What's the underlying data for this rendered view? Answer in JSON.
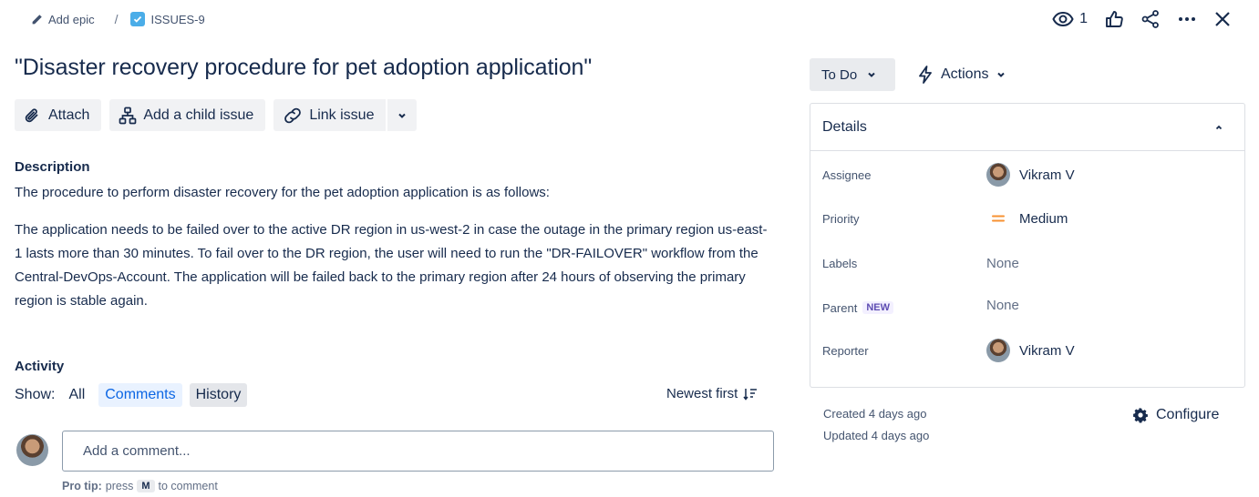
{
  "breadcrumb": {
    "epic_label": "Add epic",
    "separator": "/",
    "issue_key": "ISSUES-9"
  },
  "topbar": {
    "watch_count": "1"
  },
  "issue": {
    "title": "\"Disaster recovery procedure for pet adoption application\""
  },
  "toolbar": {
    "attach_label": "Attach",
    "child_issue_label": "Add a child issue",
    "link_issue_label": "Link issue"
  },
  "description": {
    "heading": "Description",
    "intro": "The procedure to perform disaster recovery for the pet adoption application is as follows:",
    "body": "The application needs to be failed over to the active DR region in us-west-2 in case the outage in the primary region us-east-1 lasts more than 30 minutes. To fail over to the DR region, the user will need to run the \"DR-FAILOVER\" workflow from the Central-DevOps-Account. The application will be failed back to the primary region after 24 hours of observing the primary region is stable again."
  },
  "activity": {
    "heading": "Activity",
    "show_label": "Show:",
    "filters": [
      "All",
      "Comments",
      "History"
    ],
    "sort_label": "Newest first",
    "comment_placeholder": "Add a comment...",
    "protip_prefix": "Pro tip:",
    "protip_press": "press",
    "protip_key": "M",
    "protip_suffix": "to comment"
  },
  "status": {
    "label": "To Do",
    "actions_label": "Actions"
  },
  "details": {
    "heading": "Details",
    "assignee_label": "Assignee",
    "assignee": "Vikram V",
    "priority_label": "Priority",
    "priority": "Medium",
    "labels_label": "Labels",
    "labels": "None",
    "parent_label": "Parent",
    "parent_badge": "NEW",
    "parent": "None",
    "reporter_label": "Reporter",
    "reporter": "Vikram V"
  },
  "meta": {
    "created": "Created 4 days ago",
    "updated": "Updated 4 days ago",
    "configure_label": "Configure"
  },
  "colors": {
    "link_blue": "#0c66e4",
    "priority_orange": "#f79232",
    "checkbox_blue": "#4bade8"
  }
}
